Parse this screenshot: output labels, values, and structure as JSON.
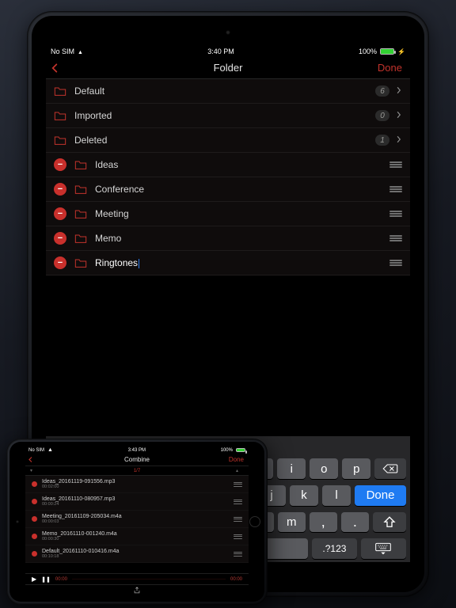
{
  "statusbar": {
    "carrier": "No SIM",
    "time": "3:40 PM",
    "battery_pct": "100%"
  },
  "nav": {
    "title": "Folder",
    "done": "Done"
  },
  "system_folders": [
    {
      "name": "Default",
      "count": "6"
    },
    {
      "name": "Imported",
      "count": "0"
    },
    {
      "name": "Deleted",
      "count": "1"
    }
  ],
  "user_folders": [
    {
      "name": "Ideas"
    },
    {
      "name": "Conference"
    },
    {
      "name": "Meeting"
    },
    {
      "name": "Memo"
    },
    {
      "name": "Ringtones",
      "editing": true
    }
  ],
  "keyboard": {
    "letters_row2_tail": [
      "o",
      "p"
    ],
    "letters_row3_tail": [
      "k",
      "l"
    ],
    "done": "Done",
    "punct": [
      ",",
      "!",
      ".",
      "?"
    ],
    "numswitch": ".?123"
  },
  "combine": {
    "status_time": "3:43 PM",
    "title": "Combine",
    "done": "Done",
    "select_header": "1/7",
    "clips": [
      {
        "name": "Ideas_20161119-091556.mp3",
        "duration": "00:02:00"
      },
      {
        "name": "Ideas_20161110-080957.mp3",
        "duration": "00:00:24"
      },
      {
        "name": "Meeting_20161109-205034.m4a",
        "duration": "00:00:03"
      },
      {
        "name": "Memo_20161110-001240.m4a",
        "duration": "00:00:30"
      },
      {
        "name": "Default_20161110-010416.m4a",
        "duration": "00:10:18"
      }
    ],
    "play_t0": "00:00",
    "play_t1": "00:00"
  }
}
